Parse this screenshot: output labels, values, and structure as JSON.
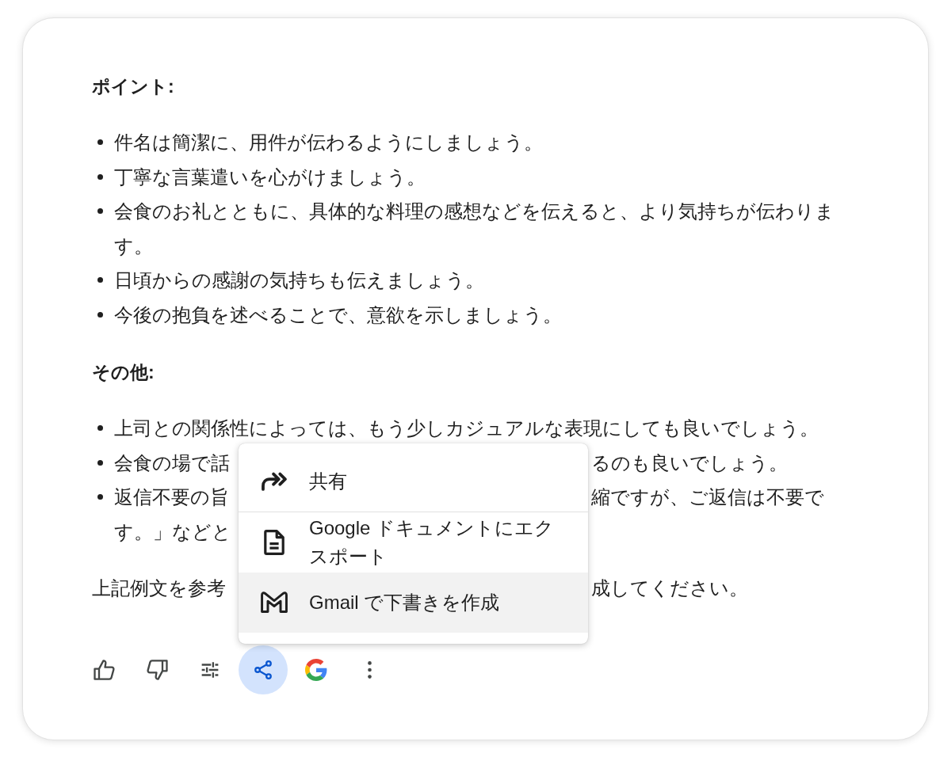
{
  "sections": [
    {
      "heading": "ポイント:",
      "items": [
        {
          "kind": "full",
          "text": "件名は簡潔に、用件が伝わるようにしましょう。"
        },
        {
          "kind": "full",
          "text": "丁寧な言葉遣いを心がけましょう。"
        },
        {
          "kind": "full",
          "text": "会食のお礼とともに、具体的な料理の感想などを伝えると、より気持ちが伝わります。"
        },
        {
          "kind": "full",
          "text": "日頃からの感謝の気持ちも伝えましょう。"
        },
        {
          "kind": "full",
          "text": "今後の抱負を述べることで、意欲を示しましょう。"
        }
      ]
    },
    {
      "heading": "その他:",
      "items": [
        {
          "kind": "full",
          "text": "上司との関係性によっては、もう少しカジュアルな表現にしても良いでしょう。"
        },
        {
          "kind": "covered",
          "lines": [
            {
              "left": "会食の場で話",
              "right": "るのも良いでしょう。"
            }
          ]
        },
        {
          "kind": "covered",
          "lines": [
            {
              "left": "返信不要の旨",
              "right": "縮ですが、ご返信は不要で"
            },
            {
              "left": "す。」などと"
            }
          ]
        }
      ]
    }
  ],
  "closing": {
    "left": "上記例文を参考",
    "right": "成してください。"
  },
  "toolbar": {
    "buttons": [
      {
        "kind": "like",
        "active": false
      },
      {
        "kind": "dislike",
        "active": false
      },
      {
        "kind": "modify",
        "active": false
      },
      {
        "kind": "share",
        "active": true
      },
      {
        "kind": "google",
        "active": false
      },
      {
        "kind": "more",
        "active": false
      }
    ]
  },
  "share_menu": {
    "groups": [
      {
        "items": [
          {
            "kind": "share",
            "label": "共有",
            "highlighted": false
          }
        ]
      },
      {
        "items": [
          {
            "kind": "docs",
            "label": "Google ドキュメントにエクスポート",
            "highlighted": false
          },
          {
            "kind": "gmail",
            "label": "Gmail で下書きを作成",
            "highlighted": true
          }
        ]
      }
    ]
  }
}
